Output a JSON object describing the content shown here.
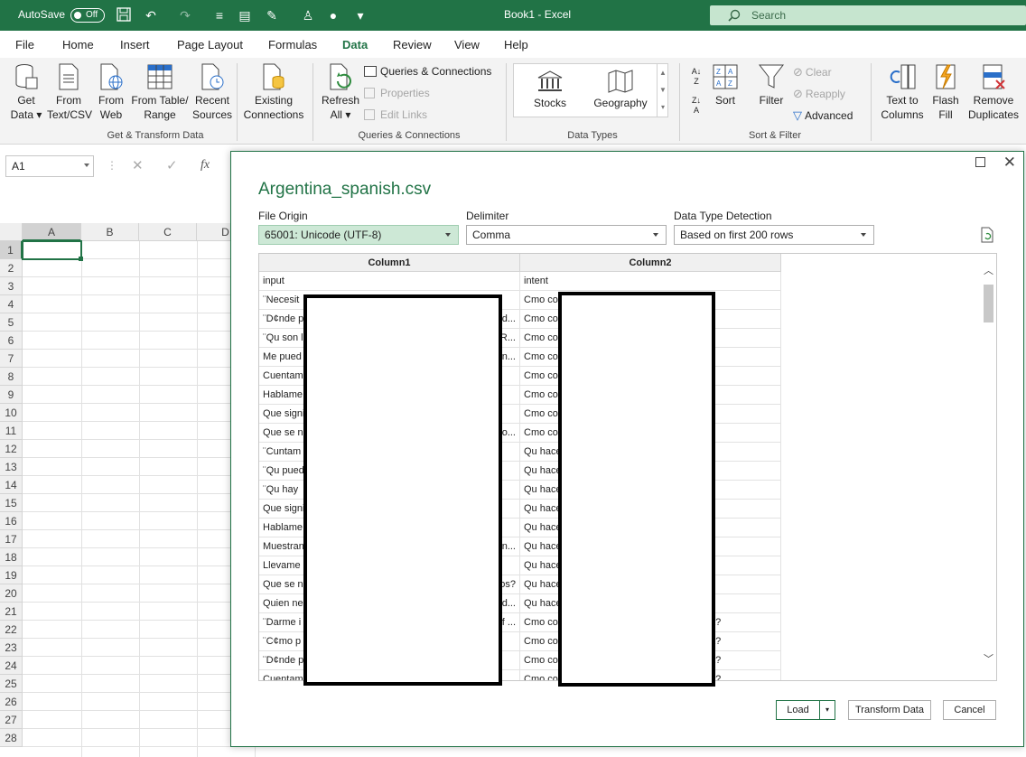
{
  "titlebar": {
    "autosave_label": "AutoSave",
    "autosave_state": "Off",
    "doc_title": "Book1  -  Excel",
    "search_placeholder": "Search",
    "bg_color": "#217346"
  },
  "menu": [
    "File",
    "Home",
    "Insert",
    "Page Layout",
    "Formulas",
    "Data",
    "Review",
    "View",
    "Help"
  ],
  "menu_active": "Data",
  "ribbon": {
    "get_data": [
      "Get",
      "Data"
    ],
    "from_text": [
      "From",
      "Text/CSV"
    ],
    "from_web": [
      "From",
      "Web"
    ],
    "from_table": [
      "From Table/",
      "Range"
    ],
    "recent_sources": [
      "Recent",
      "Sources"
    ],
    "existing_connections": [
      "Existing",
      "Connections"
    ],
    "group_get_transform": "Get & Transform Data",
    "refresh_all": [
      "Refresh",
      "All"
    ],
    "queries_connections": "Queries & Connections",
    "properties": "Properties",
    "edit_links": "Edit Links",
    "group_queries": "Queries & Connections",
    "stocks": "Stocks",
    "geography": "Geography",
    "group_data_types": "Data Types",
    "sort": "Sort",
    "filter": "Filter",
    "clear": "Clear",
    "reapply": "Reapply",
    "advanced": "Advanced",
    "group_sort_filter": "Sort & Filter",
    "text_to_columns": [
      "Text to",
      "Columns"
    ],
    "flash_fill": [
      "Flash",
      "Fill"
    ],
    "remove_duplicates": [
      "Remove",
      "Duplicates"
    ]
  },
  "formula_bar": {
    "name_box": "A1",
    "fx": "fx"
  },
  "grid": {
    "columns": [
      "A",
      "B",
      "C",
      "D"
    ],
    "rows": [
      "1",
      "2",
      "3",
      "4",
      "5",
      "6",
      "7",
      "8",
      "9",
      "10",
      "11",
      "12",
      "13",
      "14",
      "15",
      "16",
      "17",
      "18",
      "19",
      "20",
      "21",
      "22",
      "23",
      "24",
      "25",
      "26",
      "27",
      "28"
    ]
  },
  "dialog": {
    "title": "Argentina_spanish.csv",
    "file_origin_label": "File Origin",
    "file_origin_value": "65001: Unicode (UTF-8)",
    "delimiter_label": "Delimiter",
    "delimiter_value": "Comma",
    "detection_label": "Data Type Detection",
    "detection_value": "Based on first 200 rows",
    "col_headers": [
      "Column1",
      "Column2"
    ],
    "col1": [
      "input",
      "¨Necesit",
      "¨D¢nde p",
      "¨Qu son l",
      "Me pued",
      "Cuentam",
      "Hablame",
      "Que signi",
      "Que se n",
      "¨Cuntam",
      "¨Qu pued",
      "¨Qu hay",
      "Que signi",
      "Hablame",
      "Muestran",
      "Llevame",
      "Que se n",
      "Quien ne",
      "¨Darme i",
      "¨C¢mo p",
      "¨D¢nde p",
      "Cuentam"
    ],
    "col1_tail": [
      "",
      "",
      "d...",
      "R...",
      "n...",
      "",
      "",
      "",
      "o...",
      "",
      "",
      "",
      "",
      "",
      "n...",
      "",
      "os?",
      "d...",
      "f ...",
      "",
      "",
      ""
    ],
    "col2": [
      "intent",
      "Cmo co",
      "Cmo co",
      "Cmo co",
      "Cmo co",
      "Cmo co",
      "Cmo co",
      "Cmo co",
      "Cmo co",
      "Qu hace",
      "Qu hace",
      "Qu hace",
      "Qu hace",
      "Qu hace",
      "Qu hace",
      "Qu hace",
      "Qu hace",
      "Qu hace",
      "Cmo co",
      "Cmo co",
      "Cmo co",
      "Cmo co"
    ],
    "col2_tail": [
      "",
      "",
      "",
      "",
      "",
      "",
      "",
      "",
      "",
      "",
      "",
      "",
      "",
      "",
      "",
      "",
      "",
      "",
      "a?",
      "a?",
      "a?",
      "a?"
    ],
    "load": "Load",
    "transform": "Transform Data",
    "cancel": "Cancel"
  }
}
